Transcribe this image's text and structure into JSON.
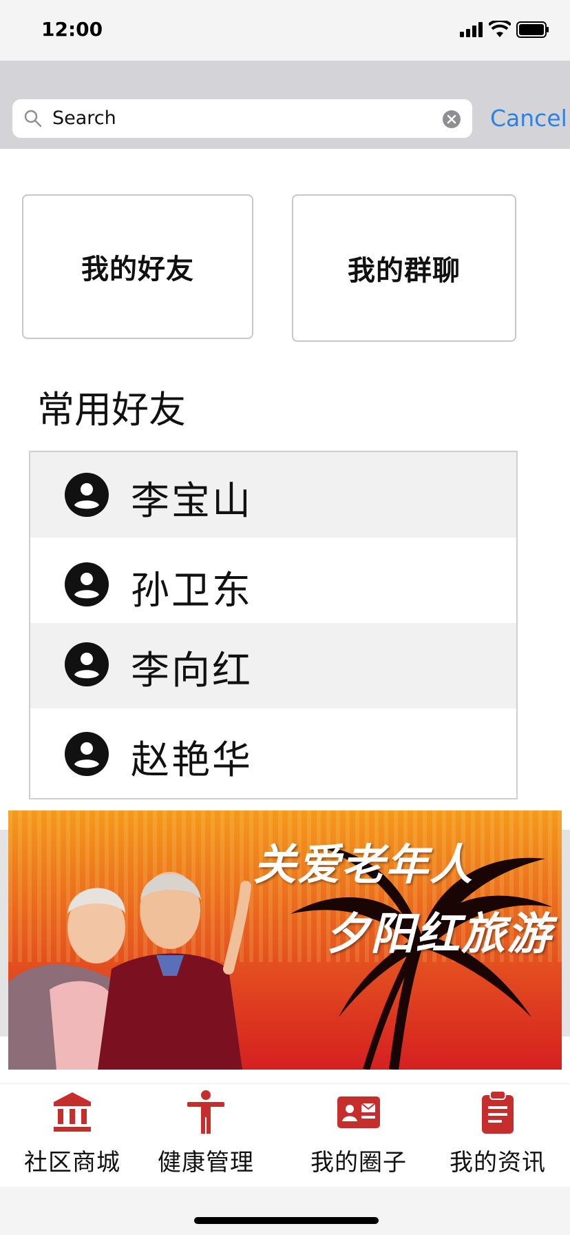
{
  "status_bar": {
    "time": "12:00"
  },
  "search": {
    "placeholder": "Search",
    "cancel_label": "Cancel"
  },
  "cards": {
    "friends_label": "我的好友",
    "groups_label": "我的群聊"
  },
  "section": {
    "title": "常用好友"
  },
  "friends": [
    {
      "name": "李宝山",
      "shaded": true
    },
    {
      "name": "孙卫东",
      "shaded": false
    },
    {
      "name": "李向红",
      "shaded": true
    },
    {
      "name": "赵艳华",
      "shaded": false
    }
  ],
  "banner": {
    "line1": "关爱老年人",
    "line2": "夕阳红旅游"
  },
  "tabbar": {
    "items": [
      {
        "label": "社区商城",
        "icon": "bank-icon"
      },
      {
        "label": "健康管理",
        "icon": "accessibility-icon"
      },
      {
        "label": "我的圈子",
        "icon": "contact-card-icon"
      },
      {
        "label": "我的资讯",
        "icon": "clipboard-icon"
      }
    ],
    "accent_color": "#c62d2d"
  },
  "colors": {
    "link": "#2a82e4",
    "row_shade": "#f1f1f1"
  }
}
